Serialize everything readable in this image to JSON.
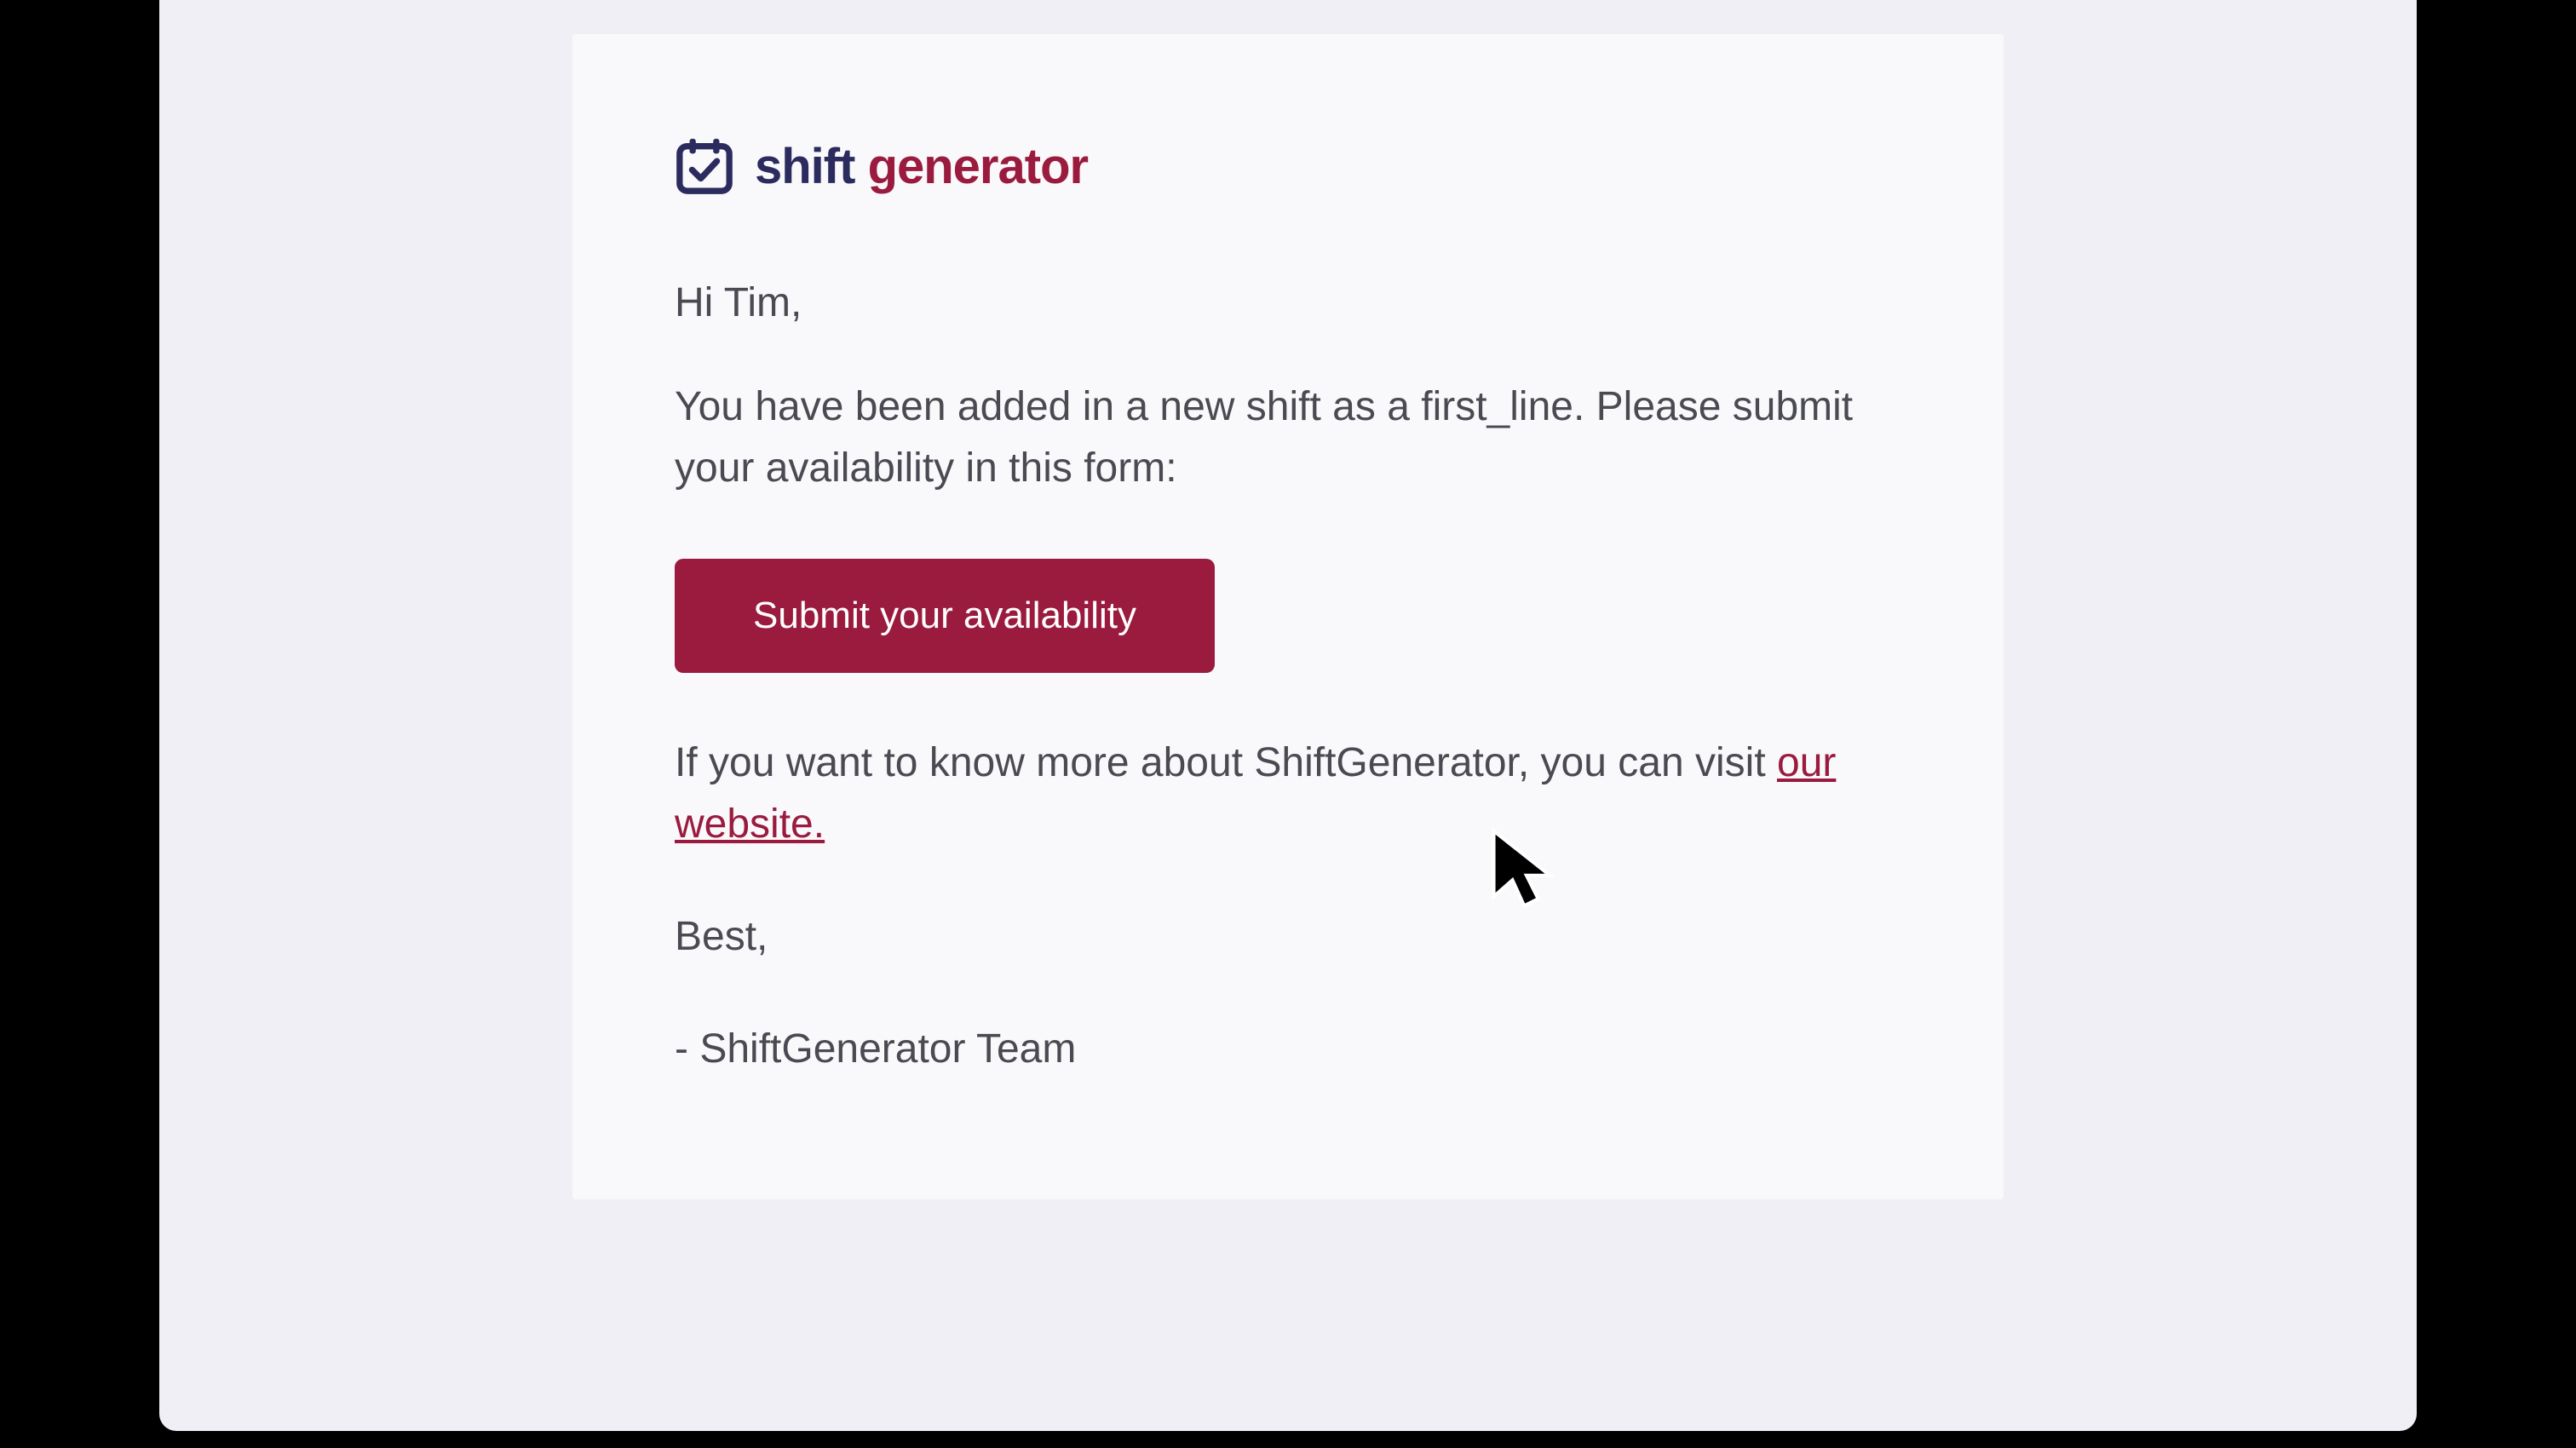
{
  "logo": {
    "word1": "shift",
    "word2": "generator"
  },
  "email": {
    "greeting": "Hi Tim,",
    "intro": "You have been added in a new shift as a first_line. Please submit your availability in this form:",
    "cta_label": "Submit your availability",
    "info_prefix": "If you want to know more about ShiftGenerator, you can visit ",
    "info_link_text": "our website.",
    "closing": "Best,",
    "signature": "- ShiftGenerator Team"
  },
  "colors": {
    "brand_dark": "#2b2b5e",
    "brand_accent": "#9a1b3e",
    "text": "#4a4a52",
    "card_bg": "#f9f8fb",
    "outer_bg": "#f0eff5"
  }
}
